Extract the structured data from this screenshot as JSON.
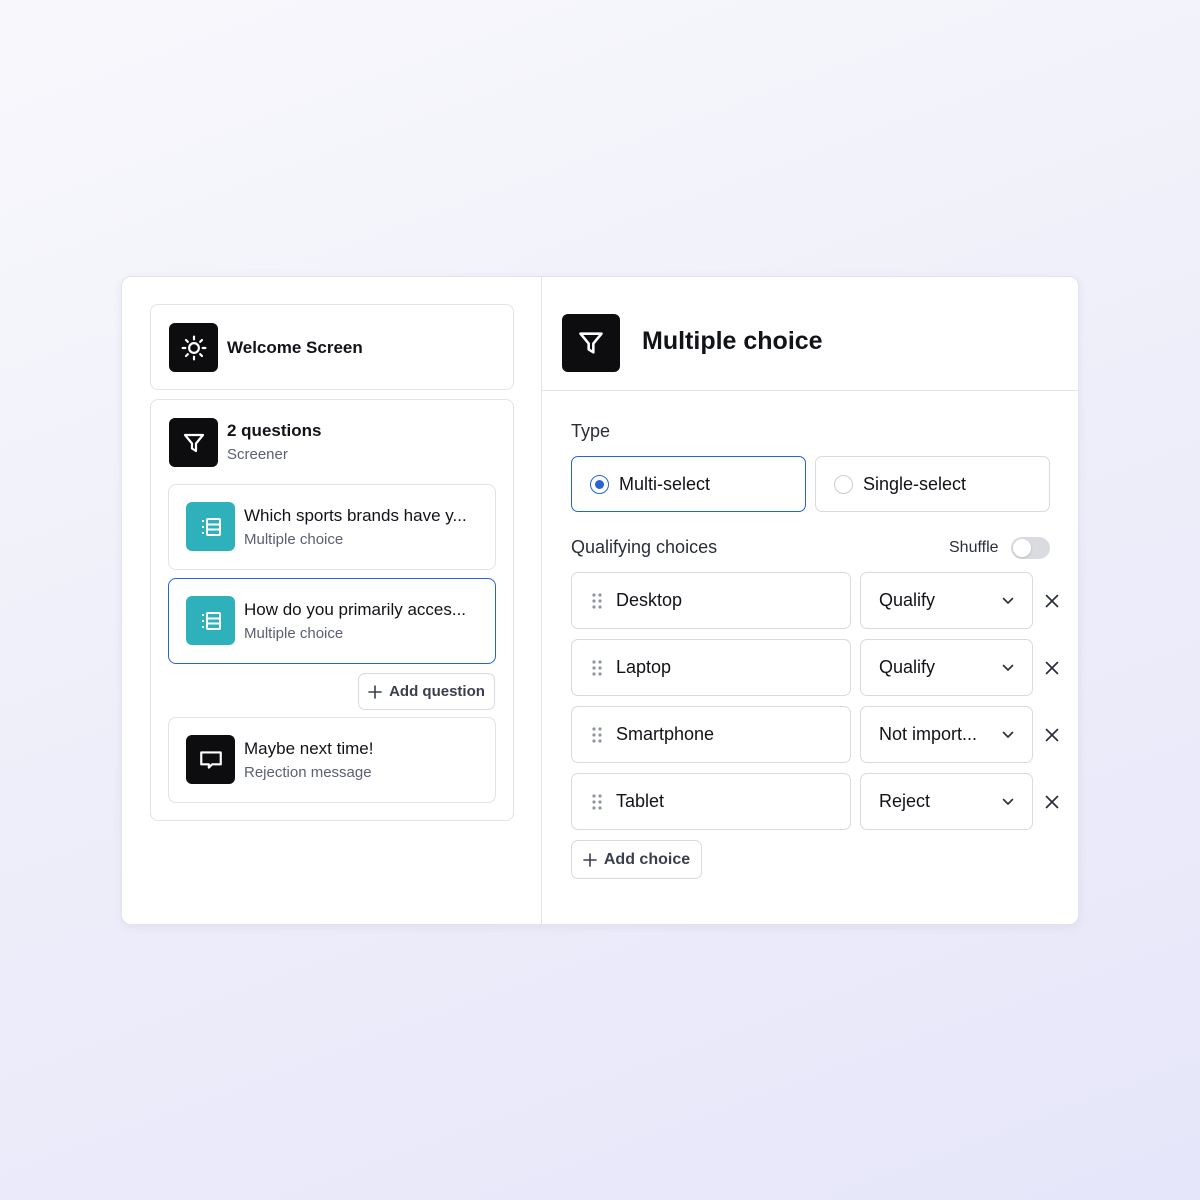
{
  "sidebar": {
    "welcome": {
      "title": "Welcome Screen",
      "icon": "sun-icon"
    },
    "screener": {
      "title": "2 questions",
      "subtitle": "Screener",
      "icon": "filter-icon"
    },
    "questions": [
      {
        "title": "Which sports brands have y...",
        "subtitle": "Multiple choice",
        "icon": "list-icon",
        "selected": false
      },
      {
        "title": "How do you primarily acces...",
        "subtitle": "Multiple choice",
        "icon": "list-icon",
        "selected": true
      }
    ],
    "add_question_label": "Add question",
    "rejection": {
      "title": "Maybe next time!",
      "subtitle": "Rejection message",
      "icon": "message-icon"
    }
  },
  "editor": {
    "title": "Multiple choice",
    "type_label": "Type",
    "type_options": [
      {
        "label": "Multi-select",
        "selected": true
      },
      {
        "label": "Single-select",
        "selected": false
      }
    ],
    "qualifying_label": "Qualifying choices",
    "shuffle_label": "Shuffle",
    "shuffle_on": false,
    "choices": [
      {
        "label": "Desktop",
        "rule": "Qualify"
      },
      {
        "label": "Laptop",
        "rule": "Qualify"
      },
      {
        "label": "Smartphone",
        "rule": "Not import..."
      },
      {
        "label": "Tablet",
        "rule": "Reject"
      }
    ],
    "add_choice_label": "Add choice"
  },
  "colors": {
    "accent": "#2563d9",
    "teal": "#2fb1bb",
    "icon_bg": "#0d0d0f"
  }
}
